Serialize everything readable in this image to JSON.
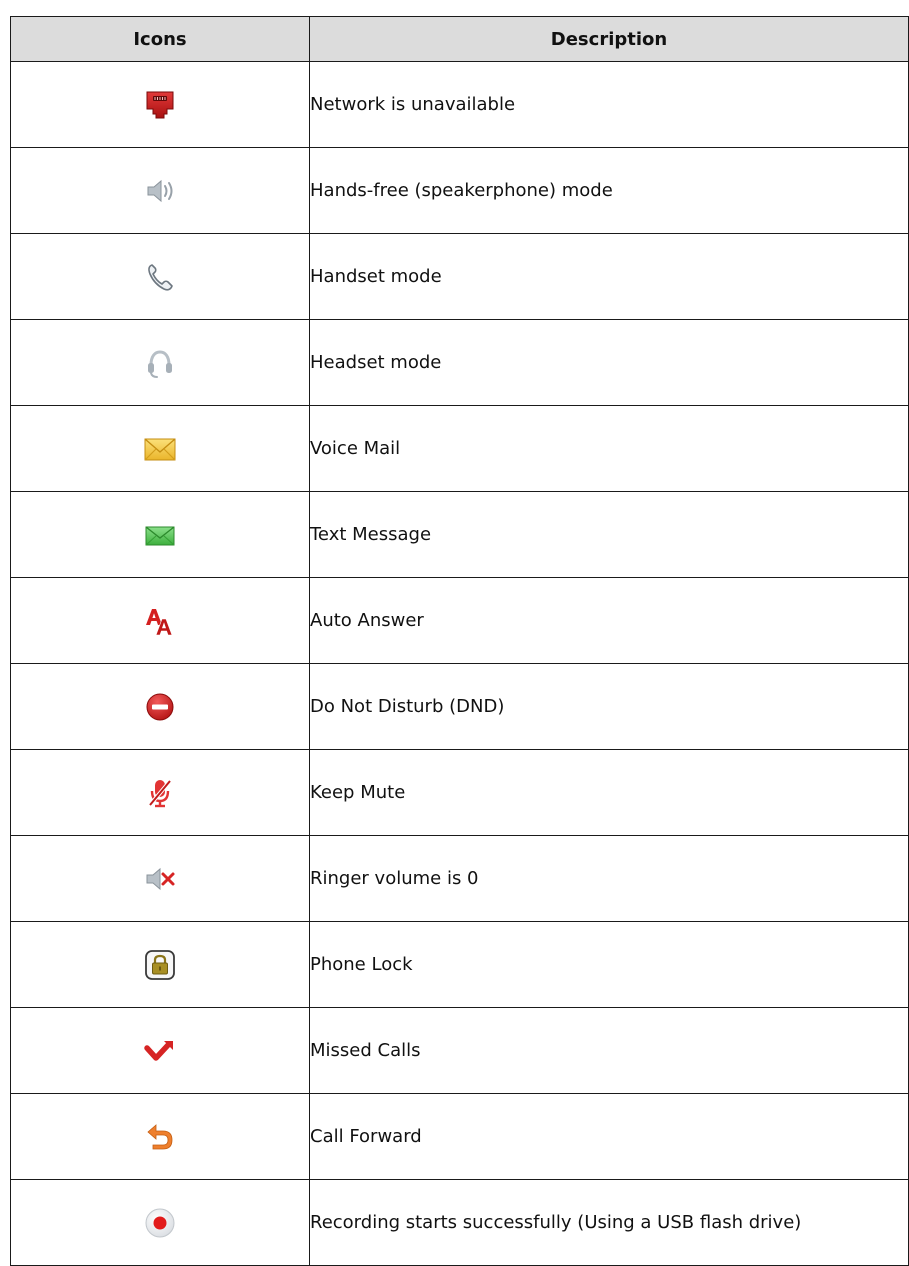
{
  "table": {
    "headers": {
      "icons": "Icons",
      "description": "Description"
    },
    "rows": [
      {
        "icon": "network-unavailable-icon",
        "description": "Network is unavailable"
      },
      {
        "icon": "speakerphone-icon",
        "description": "Hands-free (speakerphone) mode"
      },
      {
        "icon": "handset-icon",
        "description": "Handset mode"
      },
      {
        "icon": "headset-icon",
        "description": "Headset mode"
      },
      {
        "icon": "voice-mail-icon",
        "description": "Voice Mail"
      },
      {
        "icon": "text-message-icon",
        "description": "Text Message"
      },
      {
        "icon": "auto-answer-icon",
        "description": "Auto Answer"
      },
      {
        "icon": "do-not-disturb-icon",
        "description": "Do Not Disturb (DND)"
      },
      {
        "icon": "keep-mute-icon",
        "description": "Keep Mute"
      },
      {
        "icon": "ringer-volume-zero-icon",
        "description": "Ringer volume is 0"
      },
      {
        "icon": "phone-lock-icon",
        "description": "Phone Lock"
      },
      {
        "icon": "missed-calls-icon",
        "description": "Missed Calls"
      },
      {
        "icon": "call-forward-icon",
        "description": "Call Forward"
      },
      {
        "icon": "recording-icon",
        "description": "Recording starts successfully (Using a USB flash drive)"
      }
    ]
  },
  "colors": {
    "header_background": "#dcdcdc",
    "border": "#1a1a1a",
    "alert_red": "#cc1f1f",
    "mail_yellow": "#f3c640",
    "message_green": "#4ec04e",
    "forward_orange": "#ee7f2d",
    "icon_gray": "#9aa3ab"
  }
}
